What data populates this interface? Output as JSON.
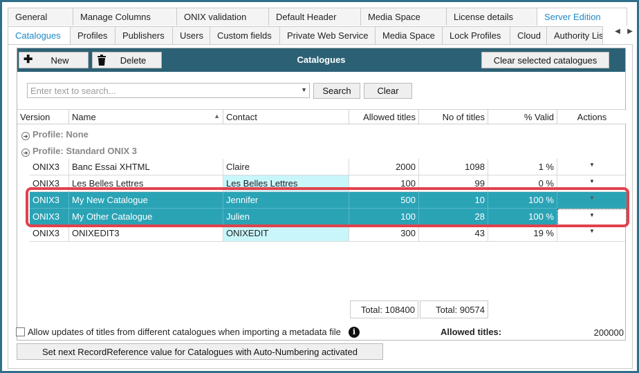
{
  "tabs_row1": [
    "General",
    "Manage Columns",
    "ONIX validation",
    "Default Header",
    "Media Space",
    "License details",
    "Server Edition"
  ],
  "tabs_row2": [
    "Catalogues",
    "Profiles",
    "Publishers",
    "Users",
    "Custom fields",
    "Private Web Service",
    "Media Space",
    "Lock Profiles",
    "Cloud",
    "Authority List"
  ],
  "toolbar": {
    "new_label": "New",
    "delete_label": "Delete",
    "title": "Catalogues",
    "clear_selected_label": "Clear selected catalogues"
  },
  "search": {
    "placeholder": "Enter text to search...",
    "search_label": "Search",
    "clear_label": "Clear"
  },
  "columns": [
    "Version",
    "Name",
    "Contact",
    "Allowed titles",
    "No of titles",
    "% Valid",
    "Actions"
  ],
  "groups": [
    {
      "label": "Profile: None"
    },
    {
      "label": "Profile: Standard ONIX 3"
    }
  ],
  "rows": [
    {
      "version": "ONIX3",
      "name": "Banc Essai XHTML",
      "contact": "Claire",
      "allowed": "2000",
      "count": "1098",
      "valid": "1 %"
    },
    {
      "version": "ONIX3",
      "name": "Les Belles Lettres",
      "contact": "Les Belles Lettres",
      "allowed": "100",
      "count": "99",
      "valid": "0 %"
    },
    {
      "version": "ONIX3",
      "name": "My New Catalogue",
      "contact": "Jennifer",
      "allowed": "500",
      "count": "10",
      "valid": "100 %"
    },
    {
      "version": "ONIX3",
      "name": "My Other Catalogue",
      "contact": "Julien",
      "allowed": "100",
      "count": "28",
      "valid": "100 %"
    },
    {
      "version": "ONIX3",
      "name": "ONIXEDIT3",
      "contact": "ONIXEDIT",
      "allowed": "300",
      "count": "43",
      "valid": "19 %"
    }
  ],
  "totals": {
    "allowed": "Total: 108400",
    "count": "Total: 90574"
  },
  "footer": {
    "allow_updates_label": "Allow updates of titles from different catalogues when importing a metadata file",
    "allowed_titles_label": "Allowed titles:",
    "allowed_titles_value": "200000",
    "record_reference_button": "Set next RecordReference value for Catalogues with Auto-Numbering activated"
  },
  "colors": {
    "header_bar": "#2c6175",
    "selected_row": "#2aa3b5",
    "highlight_border": "#e2424d",
    "active_tab_text": "#1e88c8"
  }
}
